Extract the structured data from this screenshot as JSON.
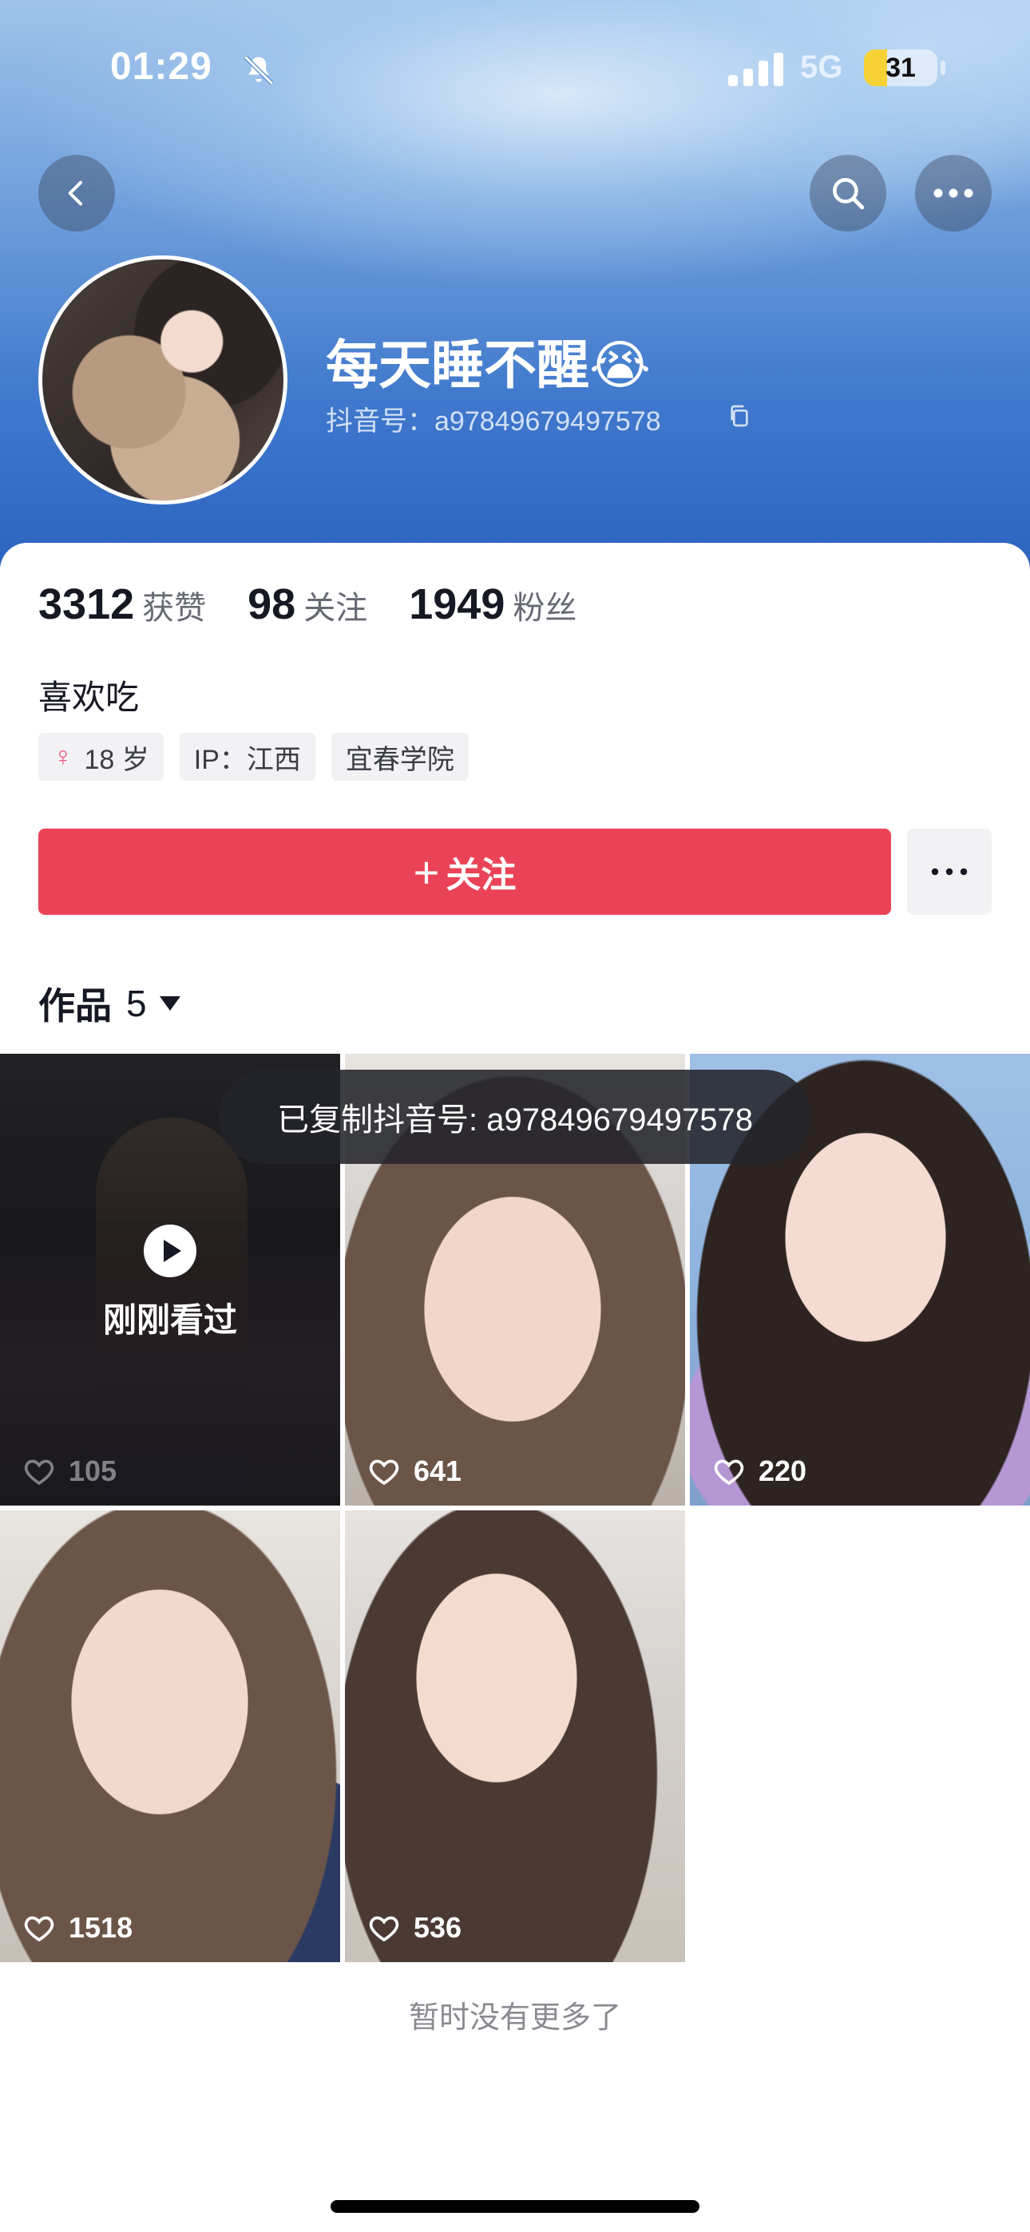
{
  "status_bar": {
    "time": "01:29",
    "network": "5G",
    "battery": "31",
    "icons": [
      "bell-muted-icon",
      "signal-icon",
      "battery-icon"
    ]
  },
  "nav": {
    "icons": [
      "back-icon",
      "search-icon",
      "more-icon"
    ]
  },
  "profile": {
    "nickname": "每天睡不醒😭",
    "douyin_id": "抖音号：a97849679497578",
    "bio": "喜欢吃"
  },
  "stats": [
    {
      "value": "3312",
      "label": "获赞"
    },
    {
      "value": "98",
      "label": "关注"
    },
    {
      "value": "1949",
      "label": "粉丝"
    }
  ],
  "tags": {
    "gender_icon": "♀",
    "age": "18 岁",
    "ip": "IP：江西",
    "school": "宜春学院"
  },
  "actions": {
    "follow_plus": "+",
    "follow_label": "关注",
    "more_icon": "more-icon"
  },
  "works": {
    "label": "作品",
    "count": "5"
  },
  "videos": [
    {
      "likes": "105",
      "overlay": "刚刚看过"
    },
    {
      "likes": "641"
    },
    {
      "likes": "220"
    },
    {
      "likes": "1518"
    },
    {
      "likes": "536"
    }
  ],
  "toast": "已复制抖音号: a97849679497578",
  "footer": "暂时没有更多了",
  "colors": {
    "follow_button": "#ea4357",
    "banner_top": "#9fc3ea",
    "banner_bottom": "#2b63c0",
    "battery": "#f7d237"
  }
}
